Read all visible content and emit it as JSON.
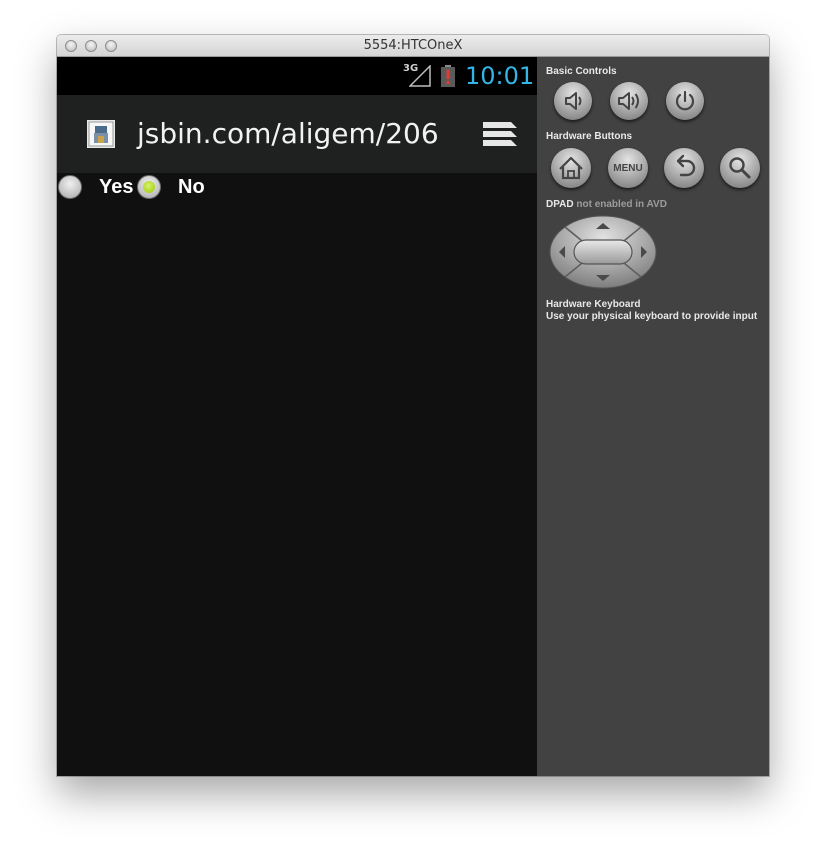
{
  "window": {
    "title": "5554:HTCOneX"
  },
  "statusbar": {
    "network": "3G",
    "clock": "10:01",
    "clock_color": "#33b5e5",
    "icons": [
      "signal-icon",
      "battery-alert-icon"
    ]
  },
  "browser": {
    "url": "jsbin.com/aligem/206",
    "icons": [
      "favicon-icon",
      "tabs-icon"
    ]
  },
  "form": {
    "options": [
      {
        "label": "Yes",
        "checked": false
      },
      {
        "label": "No",
        "checked": true
      }
    ],
    "radio_accent": "#99cc00"
  },
  "panel": {
    "basic_controls": {
      "title": "Basic Controls",
      "buttons": [
        "volume-down-icon",
        "volume-up-icon",
        "power-icon"
      ]
    },
    "hardware_buttons": {
      "title": "Hardware Buttons",
      "buttons": [
        "home-icon",
        "menu",
        "back-icon",
        "search-icon"
      ],
      "menu_label": "MENU"
    },
    "dpad": {
      "title": "DPAD",
      "subtitle": "not enabled in AVD"
    },
    "keyboard": {
      "title": "Hardware Keyboard",
      "subtitle": "Use your physical keyboard to provide input"
    }
  }
}
